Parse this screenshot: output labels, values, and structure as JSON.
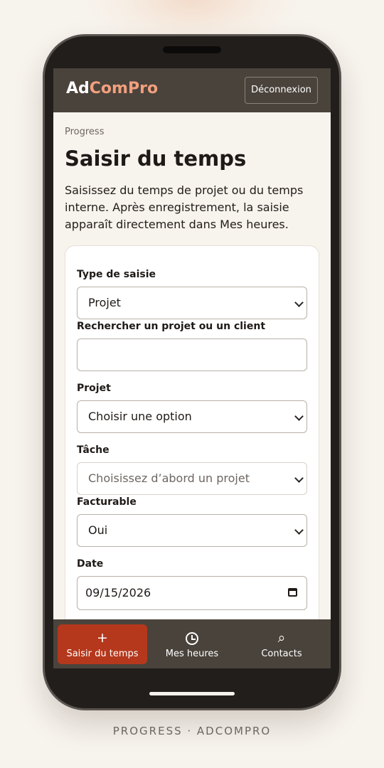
{
  "header": {
    "brand_part1": "Ad",
    "brand_part2": "ComPro",
    "logout_label": "Déconnexion"
  },
  "page": {
    "eyebrow": "Progress",
    "title": "Saisir du temps",
    "intro": "Saisissez du temps de projet ou du temps interne. Après enregistrement, la saisie apparaît directement dans Mes heures."
  },
  "form": {
    "entry_type": {
      "label": "Type de saisie",
      "value": "Projet"
    },
    "search": {
      "label": "Rechercher un projet ou un client",
      "value": "",
      "placeholder": ""
    },
    "project": {
      "label": "Projet",
      "value": "Choisir une option"
    },
    "task": {
      "label": "Tâche",
      "value": "Choisissez d’abord un projet",
      "disabled": true
    },
    "billable": {
      "label": "Facturable",
      "value": "Oui"
    },
    "date": {
      "label": "Date",
      "value": "09/15/2026"
    }
  },
  "nav": {
    "items": [
      {
        "label": "Saisir du temps",
        "icon": "plus-icon",
        "glyph": "+",
        "active": true
      },
      {
        "label": "Mes heures",
        "icon": "clock-icon",
        "active": false
      },
      {
        "label": "Contacts",
        "icon": "search-icon",
        "glyph": "⌕",
        "active": false
      }
    ]
  },
  "footer": {
    "caption": "PROGRESS · ADCOMPRO"
  },
  "colors": {
    "accent": "#b5381c",
    "brand_highlight": "#f2a07e",
    "bar_background": "#4a433c",
    "page_background": "#f7f3ed",
    "phone_body": "#221e1b"
  }
}
